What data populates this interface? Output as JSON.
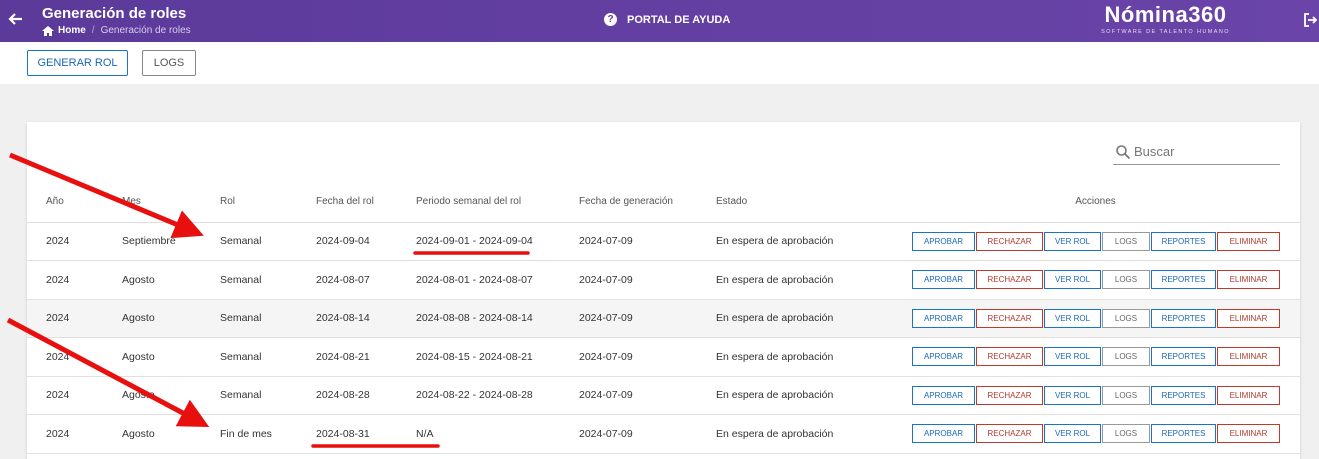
{
  "header": {
    "title": "Generación de roles",
    "breadcrumb_home": "Home",
    "breadcrumb_current": "Generación de roles",
    "help_label": "PORTAL DE AYUDA",
    "logo_name": "Nómina360",
    "logo_tagline": "SOFTWARE DE TALENTO HUMANO",
    "accent": "#5b3a9a"
  },
  "toolbar": {
    "generate_label": "GENERAR ROL",
    "logs_label": "LOGS"
  },
  "search": {
    "placeholder": "Buscar"
  },
  "table": {
    "columns": [
      "Año",
      "Mes",
      "Rol",
      "Fecha del rol",
      "Periodo semanal del rol",
      "Fecha de generación",
      "Estado",
      "Acciones"
    ],
    "actions": [
      "APROBAR",
      "RECHAZAR",
      "VER ROL",
      "LOGS",
      "REPORTES",
      "ELIMINAR"
    ],
    "rows": [
      {
        "anio": "2024",
        "mes": "Septiembre",
        "rol": "Semanal",
        "fecha": "2024-09-04",
        "periodo": "2024-09-01 - 2024-09-04",
        "generacion": "2024-07-09",
        "estado": "En espera de aprobación"
      },
      {
        "anio": "2024",
        "mes": "Agosto",
        "rol": "Semanal",
        "fecha": "2024-08-07",
        "periodo": "2024-08-01 - 2024-08-07",
        "generacion": "2024-07-09",
        "estado": "En espera de aprobación"
      },
      {
        "anio": "2024",
        "mes": "Agosto",
        "rol": "Semanal",
        "fecha": "2024-08-14",
        "periodo": "2024-08-08 - 2024-08-14",
        "generacion": "2024-07-09",
        "estado": "En espera de aprobación"
      },
      {
        "anio": "2024",
        "mes": "Agosto",
        "rol": "Semanal",
        "fecha": "2024-08-21",
        "periodo": "2024-08-15 - 2024-08-21",
        "generacion": "2024-07-09",
        "estado": "En espera de aprobación"
      },
      {
        "anio": "2024",
        "mes": "Agosto",
        "rol": "Semanal",
        "fecha": "2024-08-28",
        "periodo": "2024-08-22 - 2024-08-28",
        "generacion": "2024-07-09",
        "estado": "En espera de aprobación"
      },
      {
        "anio": "2024",
        "mes": "Agosto",
        "rol": "Fin de mes",
        "fecha": "2024-08-31",
        "periodo": "N/A",
        "generacion": "2024-07-09",
        "estado": "En espera de aprobación"
      }
    ]
  },
  "annotation_color": "#e8100f"
}
